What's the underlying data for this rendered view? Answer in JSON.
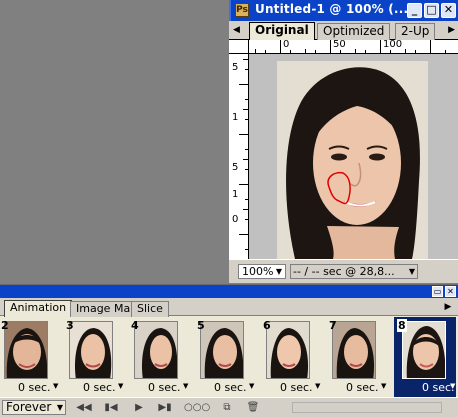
{
  "document_window": {
    "title": "Untitled-1 @ 100% (...",
    "title_icon": "Ps",
    "tabs": [
      {
        "label": "Original",
        "active": true
      },
      {
        "label": "Optimized",
        "active": false
      },
      {
        "label": "2-Up",
        "active": false
      }
    ],
    "ruler_top_ticks": [
      "0",
      "50",
      "100"
    ],
    "ruler_left_ticks": [
      "5",
      "1",
      "5",
      "1",
      "0"
    ],
    "zoom": "100%",
    "status_info": "-- / -- sec @ 28,8...",
    "controls": {
      "minimize": "_",
      "maximize": "□",
      "close": "✕"
    }
  },
  "animation_palette": {
    "tabs": [
      {
        "label": "Animation",
        "active": true
      },
      {
        "label": "Image Map",
        "active": false
      },
      {
        "label": "Slice",
        "active": false
      }
    ],
    "frames": [
      {
        "number": "2",
        "delay": "0 sec."
      },
      {
        "number": "3",
        "delay": "0 sec."
      },
      {
        "number": "4",
        "delay": "0 sec."
      },
      {
        "number": "5",
        "delay": "0 sec."
      },
      {
        "number": "6",
        "delay": "0 sec."
      },
      {
        "number": "7",
        "delay": "0 sec."
      },
      {
        "number": "8",
        "delay": "0 sec.",
        "selected": true
      }
    ],
    "loop": "Forever",
    "colors": {
      "selected_frame": "#0a246a",
      "titlebar": "#0a42c8"
    }
  }
}
